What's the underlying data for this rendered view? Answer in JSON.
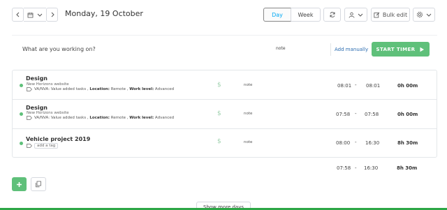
{
  "toolbar": {
    "date": "Monday, 19 October",
    "view_day": "Day",
    "view_week": "Week",
    "bulk_edit": "Bulk edit"
  },
  "icons": [
    "chevron-left-icon",
    "calendar-icon",
    "chevron-down-icon",
    "chevron-right-icon",
    "refresh-icon",
    "user-icon",
    "edit-icon",
    "gear-icon",
    "tag-icon",
    "play-icon",
    "plus-icon",
    "copy-icon"
  ],
  "colors": {
    "accent_green": "#5fc07a",
    "link_blue": "#2b6cb0",
    "active_view": "#03a9f4",
    "bottom_bar": "#2da646"
  },
  "tracker": {
    "placeholder": "What are you working on?",
    "note": "note",
    "add_manually": "Add manually",
    "start_timer": "START TIMER"
  },
  "entries": [
    {
      "title": "Design",
      "project": "New Horizons website",
      "tags_prefix": "VA/NVA: Value added tasks , ",
      "location_label": "Location:",
      "location_value": " Remote , ",
      "work_label": "Work level:",
      "work_value": " Advanced",
      "billable": "$",
      "note": "note",
      "start": "08:01",
      "sep": "-",
      "end": "08:01",
      "duration": "0h 00m"
    },
    {
      "title": "Design",
      "project": "New Horizons website",
      "tags_prefix": "VA/NVA: Value added tasks , ",
      "location_label": "Location:",
      "location_value": " Remote , ",
      "work_label": "Work level:",
      "work_value": " Advanced",
      "billable": "$",
      "note": "note",
      "start": "07:58",
      "sep": "-",
      "end": "07:58",
      "duration": "0h 00m"
    },
    {
      "title": "Vehicle project 2019",
      "add_tag": "add a tag",
      "billable": "$",
      "note": "note",
      "start": "08:00",
      "sep": "-",
      "end": "16:30",
      "duration": "8h 30m"
    }
  ],
  "totals": {
    "start": "07:58",
    "sep": "-",
    "end": "16:30",
    "duration": "8h 30m"
  },
  "footer": {
    "show_more": "Show more days"
  }
}
